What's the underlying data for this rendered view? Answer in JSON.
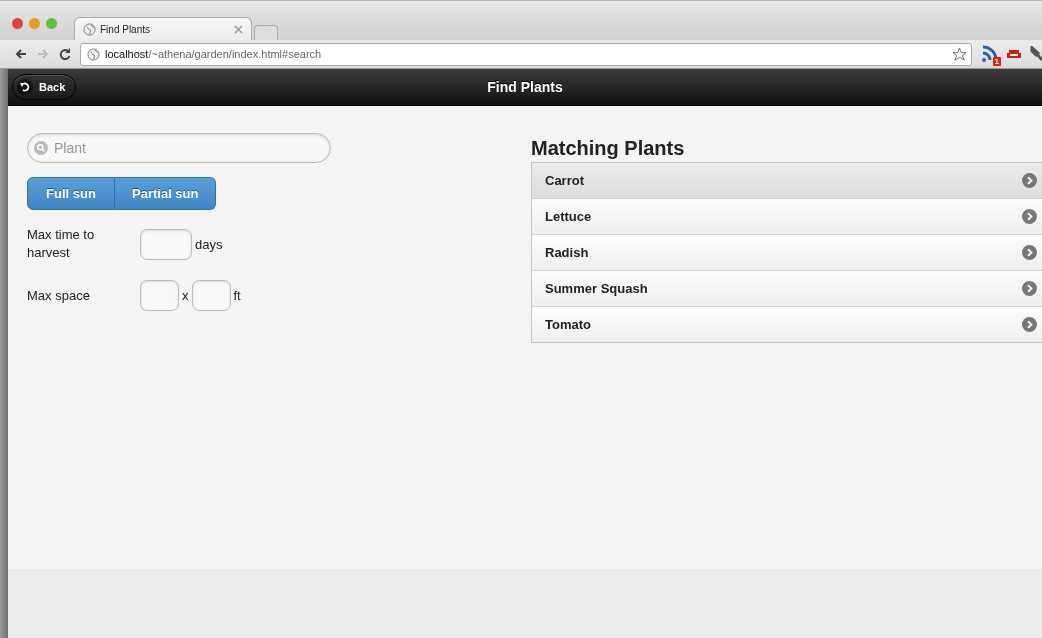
{
  "browser": {
    "tab_title": "Find Plants",
    "address": {
      "host": "localhost",
      "path": "/~athena/garden/index.html#search"
    },
    "extension_badge": "1"
  },
  "header": {
    "back": "Back",
    "title": "Find Plants"
  },
  "search": {
    "placeholder": "Plant"
  },
  "sun_options": [
    {
      "label": "Full sun",
      "selected": true
    },
    {
      "label": "Partial sun",
      "selected": true
    }
  ],
  "harvest": {
    "label": "Max time to harvest",
    "unit": "days"
  },
  "space": {
    "label": "Max space",
    "separator": "x",
    "unit": "ft"
  },
  "results": {
    "title": "Matching Plants",
    "items": [
      {
        "name": "Carrot",
        "selected": true
      },
      {
        "name": "Lettuce",
        "selected": false
      },
      {
        "name": "Radish",
        "selected": false
      },
      {
        "name": "Summer Squash",
        "selected": false
      },
      {
        "name": "Tomato",
        "selected": false
      }
    ]
  }
}
